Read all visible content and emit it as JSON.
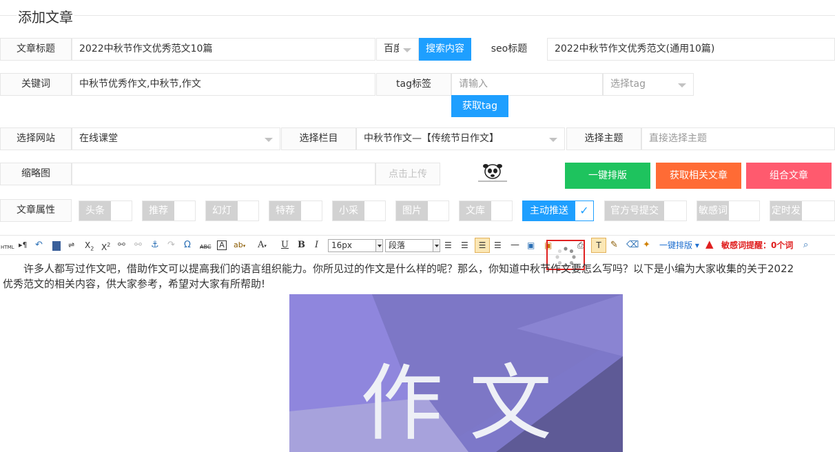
{
  "page_title": "添加文章",
  "row1": {
    "title_label": "文章标题",
    "title_value": "2022中秋节作文优秀范文10篇",
    "engine_value": "百度",
    "search_button": "搜索内容",
    "seo_label": "seo标题",
    "seo_value": "2022中秋节作文优秀范文(通用10篇)"
  },
  "row2": {
    "keyword_label": "关键词",
    "keyword_value": "中秋节优秀作文,中秋节,作文",
    "tag_label": "tag标签",
    "tag_placeholder": "请输入",
    "tag_select_placeholder": "选择tag",
    "get_tag_button": "获取tag"
  },
  "row3": {
    "site_label": "选择网站",
    "site_value": "在线课堂",
    "column_label": "选择栏目",
    "column_value": "中秋节作文—【传统节日作文】",
    "theme_label": "选择主题",
    "theme_placeholder": "直接选择主题"
  },
  "row4": {
    "thumb_label": "缩略图",
    "upload_button": "点击上传",
    "layout_button": "一键排版",
    "related_button": "获取相关文章",
    "combine_button": "组合文章"
  },
  "row5": {
    "attr_label": "文章属性",
    "attrs": [
      "头条",
      "推荐",
      "幻灯",
      "特荐",
      "小采",
      "图片",
      "文库",
      "主动推送",
      "官方号提交",
      "敏感词",
      "定时发布"
    ],
    "active_attr": "主动推送"
  },
  "toolbar": {
    "html_label": "HTML",
    "font_size": "16px",
    "paragraph": "段落",
    "layout_label": "一键排版",
    "sensitive_label": "敏感词提醒：0个词"
  },
  "content": {
    "line1": "许多人都写过作文吧，借助作文可以提高我们的语言组织能力。你所见过的作文是什么样的呢？那么，你知道中秋节作文要怎么写吗？以下是小编为大家收集的关于2022",
    "line2": "优秀范文的相关内容，供大家参考，希望对大家有所帮助!",
    "image_text": "作 文"
  },
  "colors": {
    "blue": "#1e9fff",
    "green": "#1ec35e",
    "orange": "#ff6b35",
    "red": "#ff5a6e",
    "highlight_box": "#e02020"
  }
}
